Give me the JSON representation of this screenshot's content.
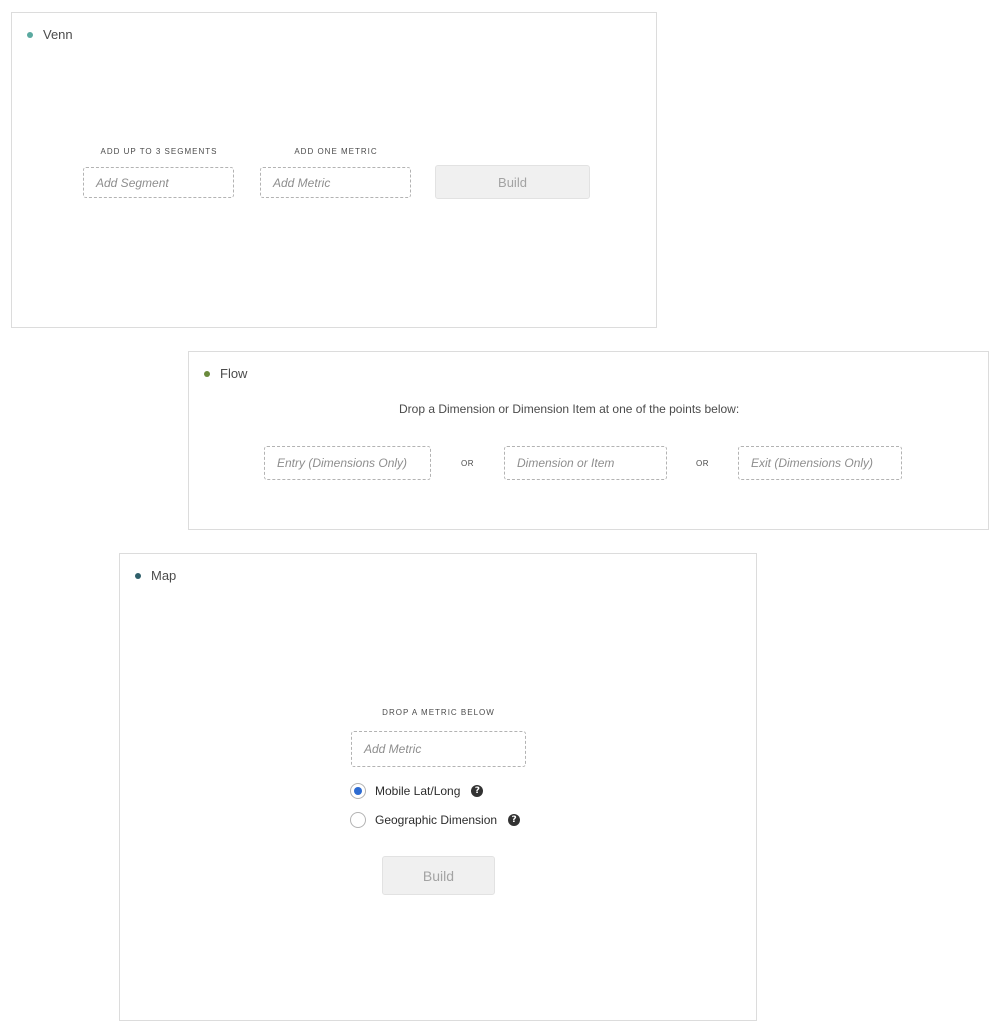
{
  "venn": {
    "title": "Venn",
    "dot_color": "#5aa9a0",
    "segments_label": "ADD UP TO 3 SEGMENTS",
    "metric_label": "ADD ONE METRIC",
    "segment_placeholder": "Add Segment",
    "metric_placeholder": "Add Metric",
    "build_label": "Build"
  },
  "flow": {
    "title": "Flow",
    "dot_color": "#6a8a3c",
    "instruction": "Drop a Dimension or Dimension Item at one of the points below:",
    "entry_placeholder": "Entry (Dimensions Only)",
    "or_1": "OR",
    "middle_placeholder": "Dimension or Item",
    "or_2": "OR",
    "exit_placeholder": "Exit (Dimensions Only)"
  },
  "map": {
    "title": "Map",
    "dot_color": "#2f5f6a",
    "metric_label": "DROP A METRIC BELOW",
    "metric_placeholder": "Add Metric",
    "options": [
      {
        "label": "Mobile Lat/Long",
        "selected": true,
        "help_icon": "question-circle-icon"
      },
      {
        "label": "Geographic Dimension",
        "selected": false,
        "help_icon": "question-circle-icon"
      }
    ],
    "build_label": "Build",
    "radio_selected_color": "#2d6bd1"
  }
}
